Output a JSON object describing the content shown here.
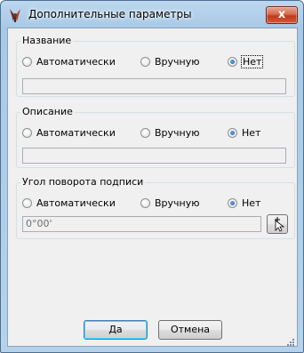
{
  "window": {
    "title": "Дополнительные параметры",
    "close_label": "x"
  },
  "groups": [
    {
      "title": "Название",
      "options": [
        "Автоматически",
        "Вручную",
        "Нет"
      ],
      "selected": 2,
      "value": ""
    },
    {
      "title": "Описание",
      "options": [
        "Автоматически",
        "Вручную",
        "Нет"
      ],
      "selected": 2,
      "value": ""
    },
    {
      "title": "Угол поворота подписи",
      "options": [
        "Автоматически",
        "Вручную",
        "Нет"
      ],
      "selected": 2,
      "value": "0°00'"
    }
  ],
  "buttons": {
    "ok": "Да",
    "cancel": "Отмена"
  },
  "icons": {
    "app": "surveying-tool-icon",
    "pick": "cursor-pick-icon"
  }
}
